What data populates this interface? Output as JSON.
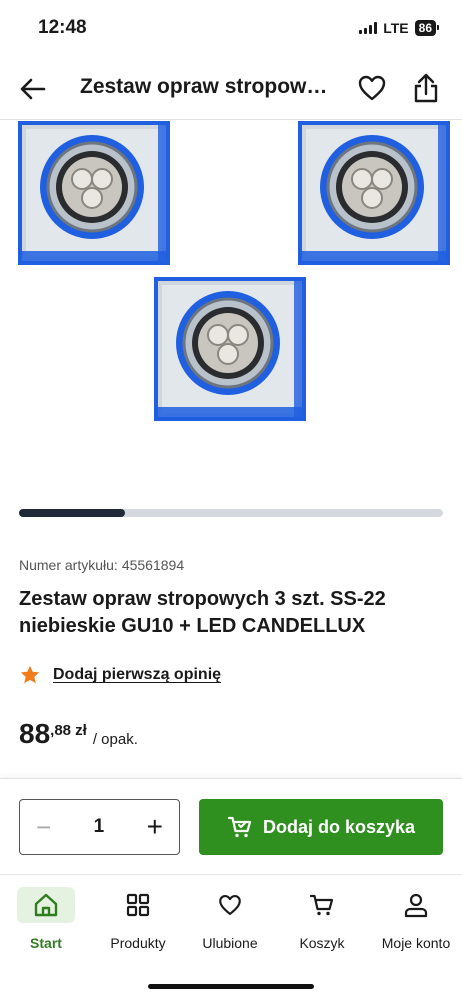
{
  "status_bar": {
    "time": "12:48",
    "network": "LTE",
    "battery": "86"
  },
  "header": {
    "title": "Zestaw opraw stropowych 3 szt. SS-22 niebieskie GU10 + LED CANDELLUX",
    "back_icon": "arrow-left-icon",
    "fav_icon": "heart-icon",
    "share_icon": "share-icon"
  },
  "gallery": {
    "image_count": 3,
    "progress": 0.25
  },
  "product": {
    "sku_label": "Numer artykułu:",
    "sku_value": "45561894",
    "title": "Zestaw opraw stropowych 3 szt. SS-22 niebieskie GU10 + LED CANDELLUX",
    "rating_link": "Dodaj pierwszą opinię",
    "price_int": "88",
    "price_cents": ",88 zł",
    "price_unit": "/ opak."
  },
  "cart": {
    "quantity": "1",
    "minus": "−",
    "plus": "+",
    "add_label": "Dodaj do koszyka"
  },
  "tabbar": {
    "items": [
      {
        "label": "Start",
        "icon": "home-icon",
        "active": true
      },
      {
        "label": "Produkty",
        "icon": "grid-icon",
        "active": false
      },
      {
        "label": "Ulubione",
        "icon": "heart-icon",
        "active": false
      },
      {
        "label": "Koszyk",
        "icon": "cart-icon",
        "active": false
      },
      {
        "label": "Moje konto",
        "icon": "user-icon",
        "active": false
      }
    ]
  },
  "colors": {
    "accent_green": "#2f8f1f",
    "active_tab_bg": "#e5f2e1",
    "lamp_blue": "#1f5fe0",
    "rating_star": "#f07c1c"
  }
}
